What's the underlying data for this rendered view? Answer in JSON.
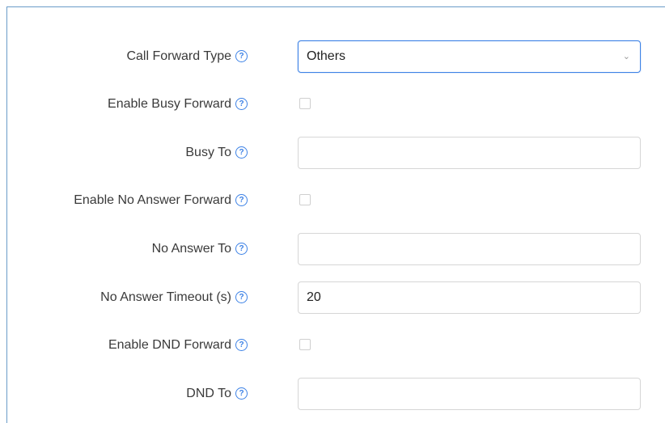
{
  "form": {
    "call_forward_type": {
      "label": "Call Forward Type",
      "value": "Others"
    },
    "enable_busy_forward": {
      "label": "Enable Busy Forward",
      "checked": false
    },
    "busy_to": {
      "label": "Busy To",
      "value": ""
    },
    "enable_no_answer_forward": {
      "label": "Enable No Answer Forward",
      "checked": false
    },
    "no_answer_to": {
      "label": "No Answer To",
      "value": ""
    },
    "no_answer_timeout": {
      "label": "No Answer Timeout (s)",
      "value": "20"
    },
    "enable_dnd_forward": {
      "label": "Enable DND Forward",
      "checked": false
    },
    "dnd_to": {
      "label": "DND To",
      "value": ""
    }
  },
  "icons": {
    "help": "question-circle-icon",
    "dropdown": "chevron-down-icon"
  },
  "colors": {
    "accent": "#3d82e6",
    "panel_border": "#6a9cc8",
    "field_border": "#d6d6d6"
  }
}
